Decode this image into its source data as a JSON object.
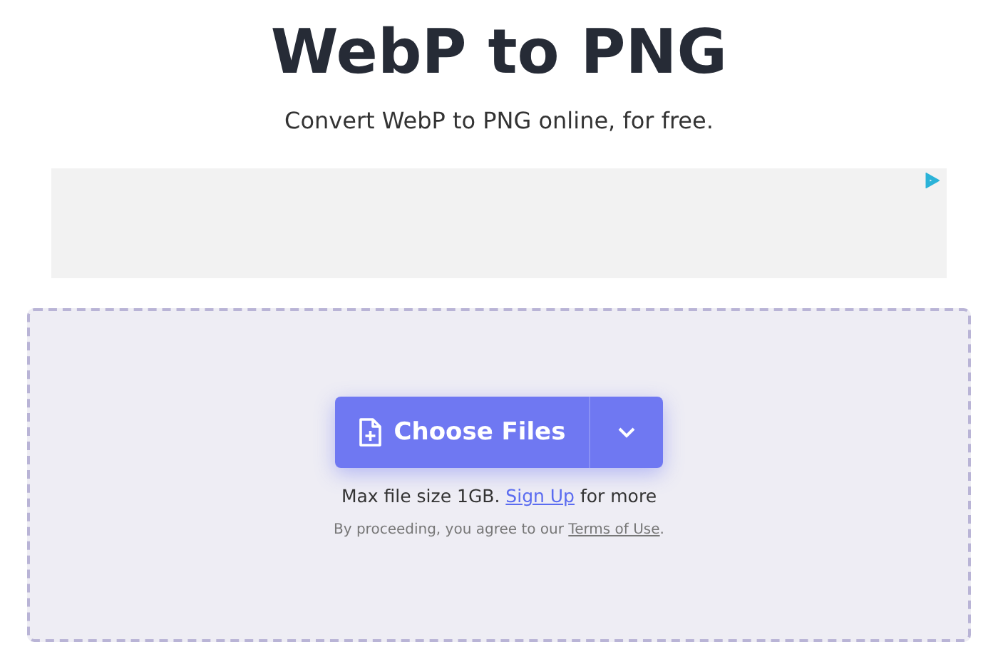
{
  "title": "WebP to PNG",
  "subtitle": "Convert WebP to PNG online, for free.",
  "ad": {
    "kind": "ad"
  },
  "upload": {
    "button": "Choose Files",
    "limit": {
      "before": "Max file size 1GB. ",
      "link": "Sign Up",
      "after": " for more"
    },
    "terms": {
      "before": "By proceeding, you agree to our ",
      "link": "Terms of Use",
      "after": "."
    }
  }
}
